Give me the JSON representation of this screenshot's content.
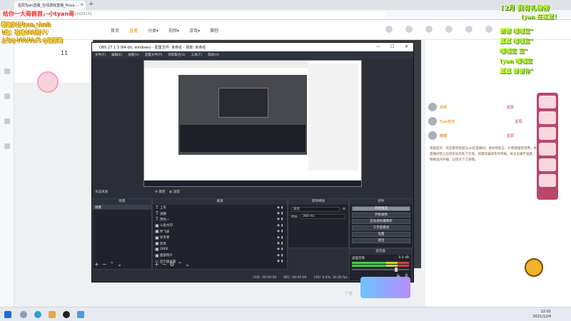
{
  "browser": {
    "tab_title": "星辰Tyan直播_在线游戏直播_Huya...",
    "tab_close": "×",
    "new_tab": "+",
    "url": "https://www.huya.com/22928141"
  },
  "site": {
    "nav": [
      "首页",
      "直播",
      "分类▾",
      "视频▾",
      "游戏▾",
      "赛程"
    ],
    "nav_active_index": 1,
    "level_num": "11",
    "chat_users": [
      {
        "name": "安娴",
        "badge": "星辰"
      },
      {
        "name": "Tyan粉丝",
        "badge": "星辰"
      },
      {
        "name": "糖糖",
        "badge": "星辰"
      }
    ],
    "chat_message": "系统提示：欢迎来到星辰Tyan的直播间，请文明发言，礼物请理性消费，本直播间禁止任何形式的私下交易，如遇诈骗请及时举报，关注主播不迷路，每晚准时开播，记得点个订阅哦。",
    "ad_label": "广告"
  },
  "overlay": {
    "line1": "给你一大哥俯首，小tyan哥",
    "line2": "感谢关注Tyan_shuii",
    "line3": "1级：投喂666的VV",
    "line4": "上车@100/1h/5 @投到哥",
    "right_title": "12月 我有礼物榜",
    "right_sub": "tyan 在这里！",
    "right_lines": [
      "谢谢 嘎嘎宝\"",
      "嘉嘉 嘎嘎宝\"",
      "嘎嘎宝 宝\"",
      "tyan 嘎嘎宝",
      "嘉嘉 谢谢你\""
    ]
  },
  "obs": {
    "title": "OBS 27.1.3 (64-bit, windows) - 配置文件: 未命名 - 场景: 未命名",
    "menu": [
      "文件(F)",
      "编辑(E)",
      "视图(V)",
      "配置文件(P)",
      "场景集合(S)",
      "工具(T)",
      "帮助(H)"
    ],
    "no_source_label": "未选择源",
    "props_button": "属性",
    "filters_button": "滤镜",
    "scenes_header": "场景",
    "scenes": [
      "场景"
    ],
    "sources_header": "来源",
    "sources": [
      {
        "icon": "text",
        "label": "上车"
      },
      {
        "icon": "text",
        "label": "进群"
      },
      {
        "icon": "text",
        "label": "用色一"
      },
      {
        "icon": "image",
        "label": "斗鱼水印"
      },
      {
        "icon": "image",
        "label": "伴飞表"
      },
      {
        "icon": "image",
        "label": "思考者"
      },
      {
        "icon": "image",
        "label": "昂贵"
      },
      {
        "icon": "image",
        "label": "2866"
      },
      {
        "icon": "image",
        "label": "面部照片"
      },
      {
        "icon": "window",
        "label": "显示器采集"
      }
    ],
    "transitions_header": "转场特效",
    "transition_value": "淡化",
    "duration_label": "时长",
    "duration_value": "300 ms",
    "controls_header": "控件",
    "controls": [
      "开始推流",
      "开始录制",
      "启动虚拟摄像机",
      "工作室模式",
      "设置",
      "退出"
    ],
    "mixer_header": "混音器",
    "mixer_channel": "桌面音频",
    "mixer_db": "0.0 dB",
    "status_live": "LIVE: 00:00:00",
    "status_rec": "REC: 00:00:00",
    "status_cpu": "CPU: 0.4%, 30.00 fps"
  },
  "taskbar": {
    "time": "12:01",
    "date": "2021/12/4"
  }
}
